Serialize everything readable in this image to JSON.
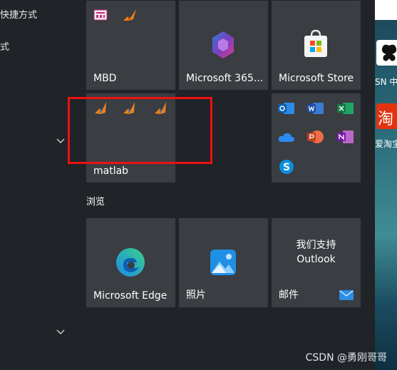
{
  "left_panel": {
    "item1": "快捷方式",
    "item2": "式"
  },
  "groups": {
    "browse_label": "浏览"
  },
  "tiles": {
    "mbd": "MBD",
    "m365": "Microsoft 365...",
    "store": "Microsoft Store",
    "matlab": "matlab",
    "edge": "Microsoft Edge",
    "photos": "照片",
    "mail_label": "邮件",
    "mail_promo_line1": "我们支持",
    "mail_promo_line2": "Outlook"
  },
  "desktop": {
    "label1": "SN 中",
    "label2": "爱淘宝",
    "taobao_glyph": "淘"
  },
  "watermark": "CSDN @勇刚哥哥",
  "colors": {
    "tile_bg": "#3a3d41",
    "start_bg": "#202327",
    "highlight": "#ee1111"
  }
}
